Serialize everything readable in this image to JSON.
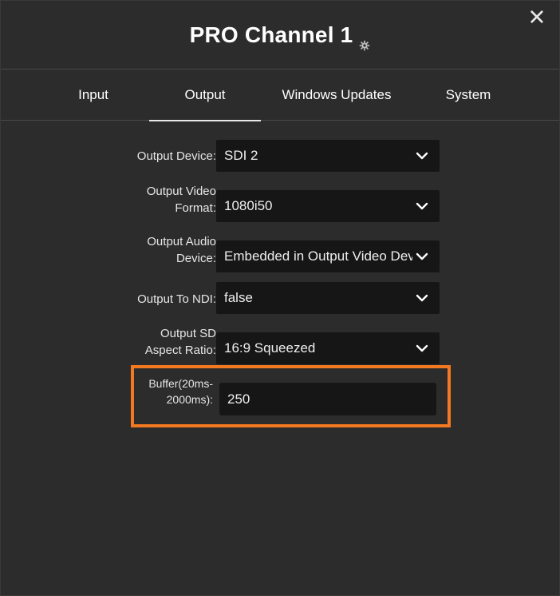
{
  "dialog": {
    "title": "PRO Channel 1",
    "title_icon": "gear-icon",
    "close_icon": "close-icon"
  },
  "tabs": [
    {
      "label": "Input",
      "active": false
    },
    {
      "label": "Output",
      "active": true
    },
    {
      "label": "Windows Updates",
      "active": false
    },
    {
      "label": "System",
      "active": false
    }
  ],
  "form": {
    "output_device": {
      "label": "Output Device:",
      "value": "SDI 2"
    },
    "output_video_format": {
      "label_line1": "Output Video",
      "label_line2": "Format:",
      "value": "1080i50"
    },
    "output_audio_device": {
      "label_line1": "Output Audio",
      "label_line2": "Device:",
      "value": "Embedded in Output Video Device"
    },
    "output_to_ndi": {
      "label": "Output To NDI:",
      "value": "false"
    },
    "output_sd_aspect_ratio": {
      "label_line1": "Output SD",
      "label_line2": "Aspect Ratio:",
      "value": "16:9 Squeezed"
    },
    "buffer": {
      "label_line1": "Buffer(20ms-",
      "label_line2": "2000ms):",
      "value": "250"
    }
  },
  "colors": {
    "background": "#2c2c2c",
    "field_background": "#161616",
    "highlight": "#f2791f",
    "text": "#ffffff"
  }
}
